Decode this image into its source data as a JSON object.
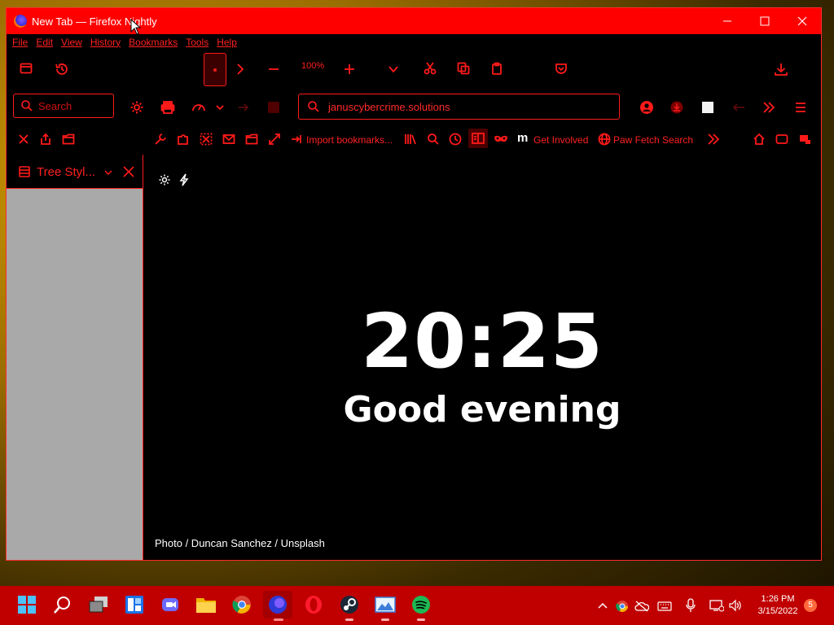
{
  "window": {
    "title": "New Tab — Firefox Nightly",
    "controls": [
      "minimize-icon",
      "maximize-icon",
      "close-icon"
    ]
  },
  "menu": [
    "File",
    "Edit",
    "View",
    "History",
    "Bookmarks",
    "Tools",
    "Help"
  ],
  "toolbar": {
    "zoom": "100%",
    "search_placeholder": "Search",
    "url": "januscybercrime.solutions"
  },
  "bookmarks": {
    "import": "Import bookmarks...",
    "get_involved": "Get Involved",
    "paw_fetch": "Paw Fetch Search"
  },
  "sidebar": {
    "title": "Tree Styl..."
  },
  "newtab": {
    "time": "20:25",
    "greeting": "Good evening",
    "credit": "Photo / Duncan Sanchez / Unsplash"
  },
  "taskbar": {
    "apps": [
      "start",
      "search",
      "task-view",
      "widgets",
      "chat",
      "file-explorer",
      "chrome",
      "firefox-nightly",
      "opera",
      "steam",
      "photos",
      "spotify"
    ],
    "time": "1:26 PM",
    "date": "3/15/2022",
    "notifications": "5"
  },
  "colors": {
    "accent": "#ff0000",
    "taskbar": "#c00000",
    "sidebar_body": "#a9a9a9"
  }
}
